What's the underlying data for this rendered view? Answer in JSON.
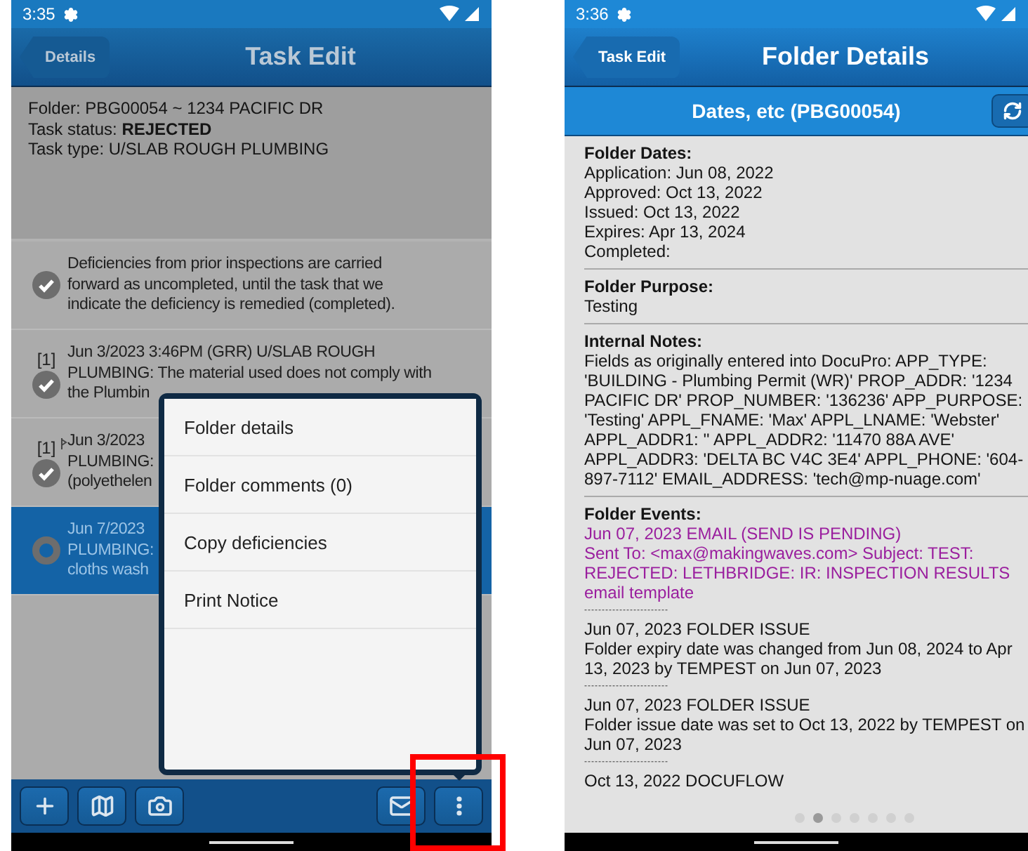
{
  "left_screen": {
    "status_bar": {
      "time": "3:35"
    },
    "header": {
      "back_button": "Details",
      "title": "Task Edit"
    },
    "info": [
      "Folder: PBG00054 ~ 1234 PACIFIC DR",
      "Task status: **REJECTED**",
      "Task type: U/SLAB ROUGH PLUMBING"
    ],
    "deficiencies": [
      {
        "checked": true,
        "selected": false,
        "flag": false,
        "lines": [
          "Deficiencies from prior inspections are carried",
          "forward as uncompleted, until the task that we",
          "indicate the deficiency is remedied (completed)."
        ]
      },
      {
        "marker": "[1]",
        "checked": true,
        "selected": false,
        "flag": false,
        "lines": [
          "Jun 3/2023 3:46PM (GRR) U/SLAB ROUGH",
          "PLUMBING: The material used does not comply with",
          "the Plumbin"
        ]
      },
      {
        "marker": "[1]",
        "checked": true,
        "selected": false,
        "flag": true,
        "lines": [
          "Jun 3/2023",
          "PLUMBING:",
          "(polyethelen"
        ]
      },
      {
        "checked": false,
        "selected": true,
        "flag": false,
        "lines": [
          "Jun 7/2023",
          "PLUMBING:",
          "cloths wash"
        ]
      }
    ],
    "menu": [
      "Folder details",
      "Folder comments (0)",
      "Copy deficiencies",
      "Print Notice"
    ],
    "toolbar": [
      {
        "kind": "add"
      },
      {
        "kind": "map"
      },
      {
        "kind": "camera"
      },
      {
        "kind": "mail"
      },
      {
        "kind": "more"
      }
    ]
  },
  "right_screen": {
    "status_bar": {
      "time": "3:36"
    },
    "header": {
      "back_button": "Task Edit",
      "title": "Folder Details"
    },
    "subheader": "Dates, etc (PBG00054)",
    "sections": [
      {
        "heading": "Folder Dates:",
        "lines": [
          "Application: Jun 08, 2022",
          "Approved: Oct 13, 2022",
          "Issued: Oct 13, 2022",
          "Expires: Apr 13, 2024",
          "Completed:"
        ]
      },
      {
        "heading": "Folder Purpose:",
        "lines": [
          "Testing"
        ]
      },
      {
        "heading": "Internal Notes:",
        "lines": [
          "Fields as originally entered into DocuPro: APP_TYPE: 'BUILDING - Plumbing Permit (WR)' PROP_ADDR: '1234 PACIFIC DR' PROP_NUMBER: '136236' APP_PURPOSE: 'Testing' APPL_FNAME: 'Max' APPL_LNAME: 'Webster' APPL_ADDR1: '' APPL_ADDR2: '11470 88A AVE' APPL_ADDR3: 'DELTA BC V4C 3E4' APPL_PHONE: '604-897-7112' EMAIL_ADDRESS: 'tech@mp-nuage.com'"
        ]
      }
    ],
    "events": {
      "heading": "Folder Events:",
      "separator": "------------------------",
      "items": [
        {
          "kind": "email",
          "title": "Jun 07, 2023 EMAIL (SEND IS PENDING)",
          "text": "Sent To: <max@makingwaves.com> Subject: TEST: REJECTED: LETHBRIDGE: IR: INSPECTION RESULTS email template"
        },
        {
          "kind": "issue",
          "title": "Jun 07, 2023 FOLDER ISSUE",
          "text": "Folder expiry date was changed from Jun 08, 2024 to Apr 13, 2023 by TEMPEST on Jun 07, 2023"
        },
        {
          "kind": "issue",
          "title": "Jun 07, 2023 FOLDER ISSUE",
          "text": "Folder issue date was set to Oct 13, 2022 by TEMPEST on Jun 07, 2023"
        },
        {
          "kind": "issue",
          "title": "Oct 13, 2022 DOCUFLOW"
        }
      ]
    },
    "pages": [
      {
        "selected": false
      },
      {
        "selected": true
      },
      {
        "selected": false
      },
      {
        "selected": false
      },
      {
        "selected": false
      },
      {
        "selected": false
      },
      {
        "selected": false
      }
    ]
  }
}
